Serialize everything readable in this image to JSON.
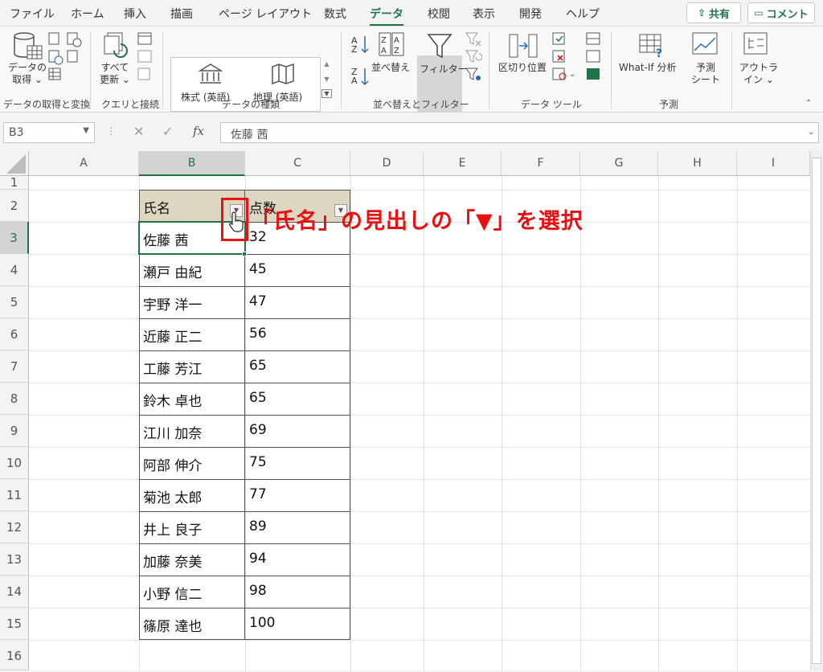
{
  "tabs": [
    "ファイル",
    "ホーム",
    "挿入",
    "描画",
    "ページ レイアウト",
    "数式",
    "データ",
    "校閲",
    "表示",
    "開発",
    "ヘルプ"
  ],
  "share_label": "共有",
  "comment_label": "コメント",
  "ribbon": {
    "get_data": "データの\n取得 ⌄",
    "refresh": "すべて\n更新 ⌄",
    "stock": "株式 (英語)",
    "geo": "地理 (英語)",
    "sort": "並べ替え",
    "filter": "フィルター",
    "text_to_col": "区切り位置",
    "whatif": "What-If 分析",
    "forecast": "予測\nシート",
    "outline": "アウトラ\nイン ⌄",
    "groups": [
      "データの取得と変換",
      "クエリと接続",
      "データの種類",
      "並べ替えとフィルター",
      "データ ツール",
      "予測"
    ]
  },
  "namebox": "B3",
  "fx": "fx",
  "formula_value": "佐藤 茜",
  "columns": [
    "A",
    "B",
    "C",
    "D",
    "E",
    "F",
    "G",
    "H",
    "I"
  ],
  "rows": [
    "1",
    "2",
    "3",
    "4",
    "5",
    "6",
    "7",
    "8",
    "9",
    "10",
    "11",
    "12",
    "13",
    "14",
    "15",
    "16"
  ],
  "table": {
    "header_name": "氏名",
    "header_score": "点数",
    "names": [
      "佐藤 茜",
      "瀬戸 由紀",
      "宇野 洋一",
      "近藤 正二",
      "工藤 芳江",
      "鈴木 卓也",
      "江川 加奈",
      "阿部 伸介",
      "菊池 太郎",
      "井上 良子",
      "加藤 奈美",
      "小野 信二",
      "篠原 達也"
    ],
    "scores": [
      "32",
      "45",
      "47",
      "56",
      "65",
      "65",
      "69",
      "75",
      "77",
      "89",
      "94",
      "98",
      "100"
    ]
  },
  "annotation": "「氏名」の見出しの「▼」を選択",
  "accent": "#217346",
  "annotation_color": "#e81010"
}
